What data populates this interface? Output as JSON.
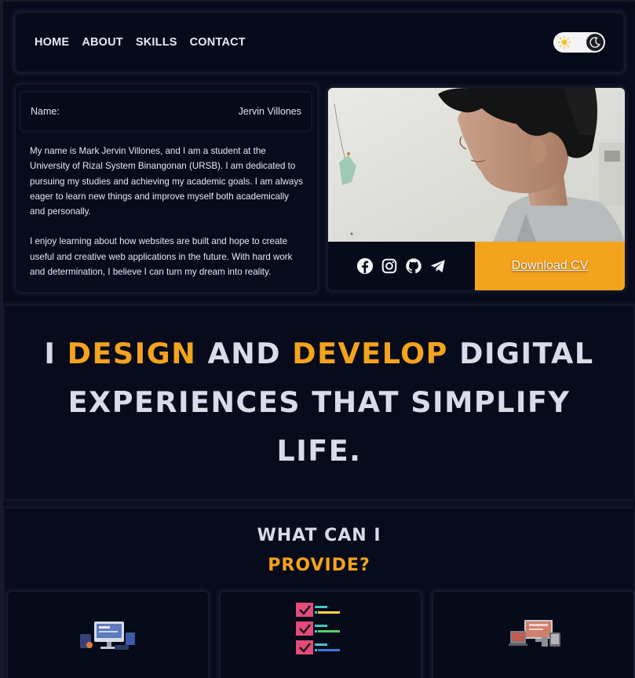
{
  "nav": {
    "links": [
      "HOME",
      "ABOUT",
      "SKILLS",
      "CONTACT"
    ],
    "theme_toggle": {
      "left_icon": "sun-icon",
      "knob_icon": "moon-icon"
    }
  },
  "profile": {
    "name_label": "Name:",
    "name_value": "Jervin Villones",
    "bio": [
      "My name is Mark Jervin Villones, and I am a student at the University of Rizal System Binangonan (URSB). I am dedicated to pursuing my studies and achieving my academic goals. I am always eager to learn new things and improve myself both academically and personally.",
      "I enjoy learning about how websites are built and hope to create useful and creative web applications in the future. With hard work and determination, I believe I can turn my dream into reality."
    ]
  },
  "photo_card": {
    "socials": [
      "facebook-icon",
      "instagram-icon",
      "github-icon",
      "telegram-icon"
    ],
    "download_label": "Download CV"
  },
  "hero": {
    "w1": "I",
    "w2": "DESIGN",
    "w3": "AND",
    "w4": "DEVELOP",
    "w5": "DIGITAL EXPERIENCES THAT SIMPLIFY LIFE."
  },
  "services": {
    "title_line1": "WHAT CAN I",
    "title_line2": "PROVIDE?",
    "cards": [
      "web-design-illustration",
      "checklist-illustration",
      "responsive-devices-illustration"
    ]
  },
  "colors": {
    "accent": "#f3a31d",
    "background": "#080b1c",
    "text": "#d9dbe7"
  }
}
